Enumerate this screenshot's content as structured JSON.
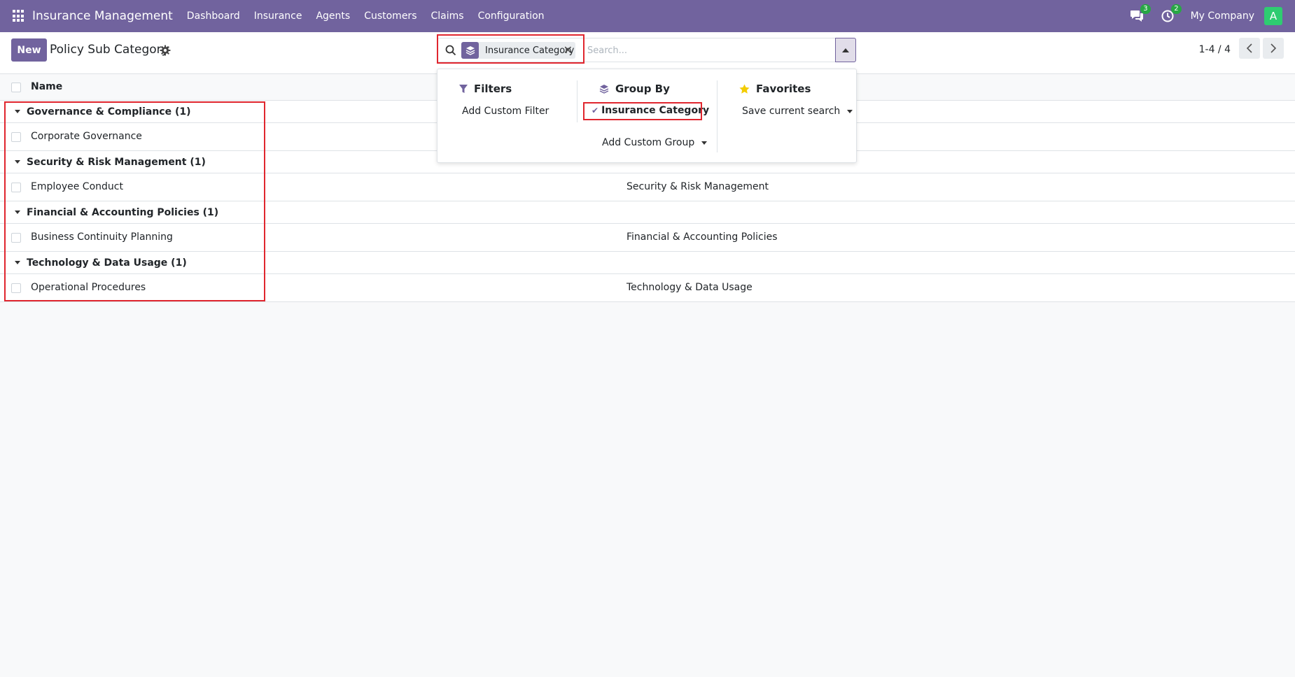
{
  "navbar": {
    "app_name": "Insurance Management",
    "menu": [
      "Dashboard",
      "Insurance",
      "Agents",
      "Customers",
      "Claims",
      "Configuration"
    ],
    "messages_count": "3",
    "activities_count": "2",
    "company": "My Company",
    "avatar_letter": "A",
    "accent_color": "#71639e"
  },
  "control_panel": {
    "new_label": "New",
    "title": "Policy Sub Category",
    "search": {
      "facet_label": "Insurance Category",
      "placeholder": "Search..."
    },
    "pager": "1-4 / 4"
  },
  "list": {
    "column_name": "Name",
    "groups": [
      {
        "label": "Governance & Compliance (1)",
        "rows": [
          {
            "name": "Corporate Governance",
            "category": ""
          }
        ]
      },
      {
        "label": "Security & Risk Management (1)",
        "rows": [
          {
            "name": "Employee Conduct",
            "category": "Security & Risk Management"
          }
        ]
      },
      {
        "label": "Financial & Accounting Policies (1)",
        "rows": [
          {
            "name": "Business Continuity Planning",
            "category": "Financial & Accounting Policies"
          }
        ]
      },
      {
        "label": "Technology & Data Usage (1)",
        "rows": [
          {
            "name": "Operational Procedures",
            "category": "Technology & Data Usage"
          }
        ]
      }
    ]
  },
  "search_panel": {
    "filters": {
      "title": "Filters",
      "add_custom": "Add Custom Filter"
    },
    "group_by": {
      "title": "Group By",
      "selected": "Insurance Category",
      "add_custom": "Add Custom Group"
    },
    "favorites": {
      "title": "Favorites",
      "save_search": "Save current search"
    }
  }
}
